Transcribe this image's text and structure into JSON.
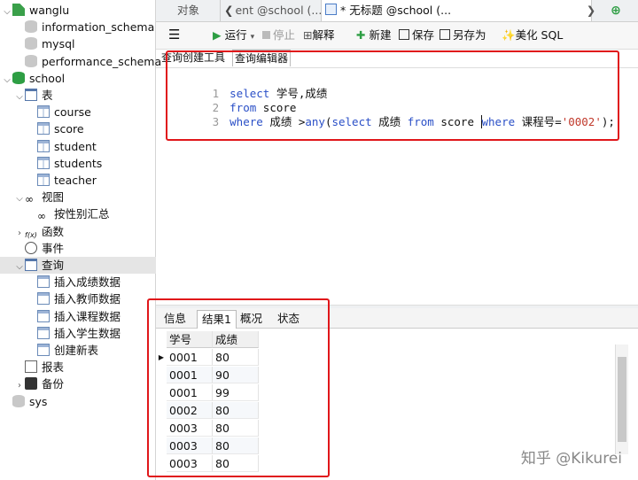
{
  "sidebar": {
    "items": [
      {
        "label": "wanglu",
        "icon": "connection-icon",
        "level": 0,
        "expand": "down"
      },
      {
        "label": "information_schema",
        "icon": "database-icon",
        "level": 1,
        "expand": ""
      },
      {
        "label": "mysql",
        "icon": "database-icon",
        "level": 1,
        "expand": ""
      },
      {
        "label": "performance_schema",
        "icon": "database-icon",
        "level": 1,
        "expand": ""
      },
      {
        "label": "school",
        "icon": "database-icon",
        "level": 0,
        "expand": "down",
        "active": true
      },
      {
        "label": "表",
        "icon": "table-folder-icon",
        "level": 1,
        "expand": "down"
      },
      {
        "label": "course",
        "icon": "table-icon",
        "level": 2,
        "expand": ""
      },
      {
        "label": "score",
        "icon": "table-icon",
        "level": 2,
        "expand": ""
      },
      {
        "label": "student",
        "icon": "table-icon",
        "level": 2,
        "expand": ""
      },
      {
        "label": "students",
        "icon": "table-icon",
        "level": 2,
        "expand": ""
      },
      {
        "label": "teacher",
        "icon": "table-icon",
        "level": 2,
        "expand": ""
      },
      {
        "label": "视图",
        "icon": "view-folder-icon",
        "level": 1,
        "expand": "down"
      },
      {
        "label": "按性别汇总",
        "icon": "view-icon",
        "level": 2,
        "expand": ""
      },
      {
        "label": "函数",
        "icon": "function-icon",
        "level": 1,
        "expand": "right"
      },
      {
        "label": "事件",
        "icon": "event-icon",
        "level": 1,
        "expand": ""
      },
      {
        "label": "查询",
        "icon": "query-folder-icon",
        "level": 1,
        "expand": "down",
        "selected": true
      },
      {
        "label": "插入成绩数据",
        "icon": "query-icon",
        "level": 2,
        "expand": ""
      },
      {
        "label": "插入教师数据",
        "icon": "query-icon",
        "level": 2,
        "expand": ""
      },
      {
        "label": "插入课程数据",
        "icon": "query-icon",
        "level": 2,
        "expand": ""
      },
      {
        "label": "插入学生数据",
        "icon": "query-icon",
        "level": 2,
        "expand": ""
      },
      {
        "label": "创建新表",
        "icon": "query-icon",
        "level": 2,
        "expand": ""
      },
      {
        "label": "报表",
        "icon": "report-icon",
        "level": 1,
        "expand": ""
      },
      {
        "label": "备份",
        "icon": "backup-icon",
        "level": 1,
        "expand": "right"
      },
      {
        "label": "sys",
        "icon": "database-icon",
        "level": 0,
        "expand": ""
      }
    ]
  },
  "tabs": {
    "objects": "对象",
    "prev_tab": "ent @school (...",
    "active_tab": "* 无标题 @school (..."
  },
  "toolbar": {
    "run": "运行",
    "stop": "停止",
    "explain": "解释",
    "new": "新建",
    "save": "保存",
    "save_as": "另存为",
    "beautify": "美化 SQL"
  },
  "subtabs": {
    "builder": "查询创建工具",
    "editor": "查询编辑器"
  },
  "editor": {
    "line_numbers": [
      "1",
      "2",
      "3"
    ],
    "line1": {
      "kw1": "select",
      "rest": " 学号,成绩"
    },
    "line2": {
      "kw1": "from",
      "rest": " score"
    },
    "line3": {
      "kw1": "where",
      "t1": " 成绩 >",
      "kw2": "any",
      "t2": "(",
      "kw3": "select",
      "t3": " 成绩 ",
      "kw4": "from",
      "t4": " score ",
      "kw5": "where",
      "t5": " 课程号=",
      "str": "'0002'",
      "t6": ");"
    }
  },
  "result_tabs": [
    "信息",
    "结果1",
    "概况",
    "状态"
  ],
  "grid": {
    "columns": [
      "学号",
      "成绩"
    ],
    "rows": [
      [
        "0001",
        "80"
      ],
      [
        "0001",
        "90"
      ],
      [
        "0001",
        "99"
      ],
      [
        "0002",
        "80"
      ],
      [
        "0003",
        "80"
      ],
      [
        "0003",
        "80"
      ],
      [
        "0003",
        "80"
      ]
    ]
  },
  "watermark": "知乎 @Kikurei",
  "colors": {
    "keyword": "#2a4fc7",
    "string": "#c0392b",
    "highlight_box": "#e0161a",
    "database_icon": "#2e9e44"
  }
}
